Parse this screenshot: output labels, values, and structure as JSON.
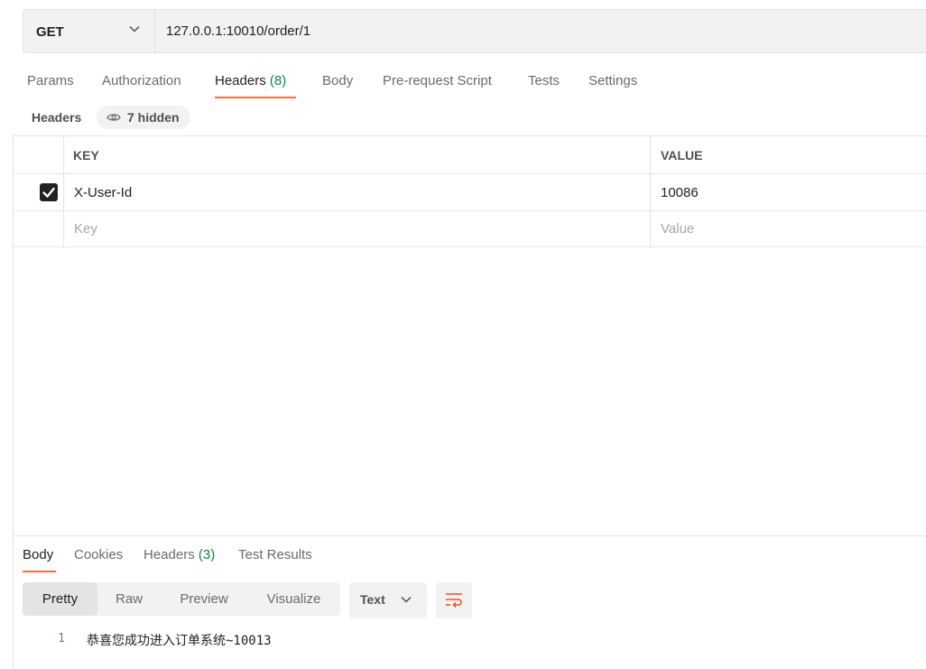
{
  "request": {
    "method": "GET",
    "url": "127.0.0.1:10010/order/1"
  },
  "request_tabs": [
    {
      "label": "Params"
    },
    {
      "label": "Authorization"
    },
    {
      "label": "Headers",
      "count": "(8)",
      "active": true
    },
    {
      "label": "Body"
    },
    {
      "label": "Pre-request Script"
    },
    {
      "label": "Tests"
    },
    {
      "label": "Settings"
    }
  ],
  "headers_section": {
    "title": "Headers",
    "hidden_label": "7 hidden",
    "columns": {
      "key": "KEY",
      "value": "VALUE"
    },
    "rows": [
      {
        "checked": true,
        "key": "X-User-Id",
        "value": "10086"
      }
    ],
    "new_row": {
      "key_placeholder": "Key",
      "value_placeholder": "Value"
    }
  },
  "response_tabs": [
    {
      "label": "Body",
      "active": true
    },
    {
      "label": "Cookies"
    },
    {
      "label": "Headers",
      "count": "(3)"
    },
    {
      "label": "Test Results"
    }
  ],
  "view_modes": [
    "Pretty",
    "Raw",
    "Preview",
    "Visualize"
  ],
  "active_view_mode": "Pretty",
  "format": "Text",
  "response_body": {
    "line_number": "1",
    "text": "恭喜您成功进入订单系统~10013"
  },
  "colors": {
    "accent": "#ff6c37",
    "count_green": "#0c8a3e"
  },
  "icons": {
    "method_dropdown": "chevron-down-icon",
    "hidden_headers": "eye-icon",
    "checkbox": "checkmark-icon",
    "format_dropdown": "chevron-down-icon",
    "wrap_lines": "wrap-lines-icon"
  }
}
